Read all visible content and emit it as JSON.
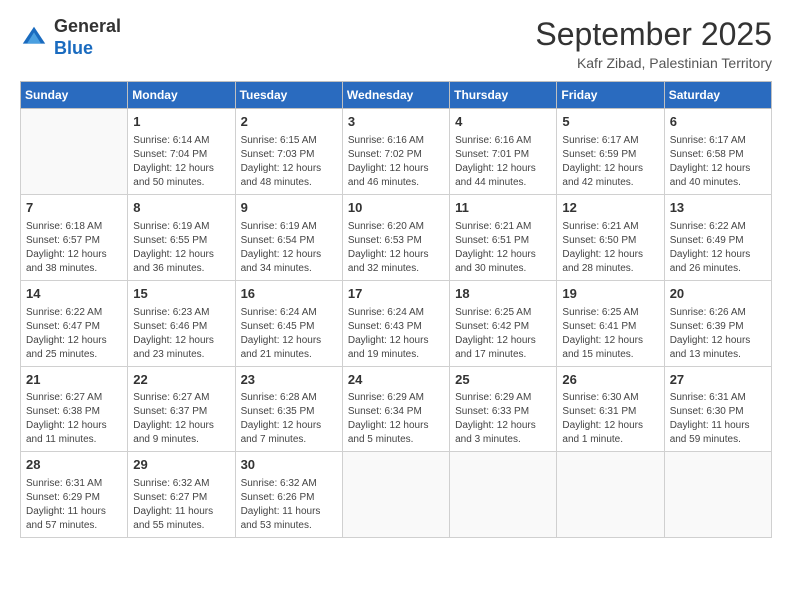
{
  "header": {
    "logo_line1": "General",
    "logo_line2": "Blue",
    "month": "September 2025",
    "location": "Kafr Zibad, Palestinian Territory"
  },
  "weekdays": [
    "Sunday",
    "Monday",
    "Tuesday",
    "Wednesday",
    "Thursday",
    "Friday",
    "Saturday"
  ],
  "weeks": [
    [
      {
        "day": "",
        "info": ""
      },
      {
        "day": "1",
        "info": "Sunrise: 6:14 AM\nSunset: 7:04 PM\nDaylight: 12 hours\nand 50 minutes."
      },
      {
        "day": "2",
        "info": "Sunrise: 6:15 AM\nSunset: 7:03 PM\nDaylight: 12 hours\nand 48 minutes."
      },
      {
        "day": "3",
        "info": "Sunrise: 6:16 AM\nSunset: 7:02 PM\nDaylight: 12 hours\nand 46 minutes."
      },
      {
        "day": "4",
        "info": "Sunrise: 6:16 AM\nSunset: 7:01 PM\nDaylight: 12 hours\nand 44 minutes."
      },
      {
        "day": "5",
        "info": "Sunrise: 6:17 AM\nSunset: 6:59 PM\nDaylight: 12 hours\nand 42 minutes."
      },
      {
        "day": "6",
        "info": "Sunrise: 6:17 AM\nSunset: 6:58 PM\nDaylight: 12 hours\nand 40 minutes."
      }
    ],
    [
      {
        "day": "7",
        "info": "Sunrise: 6:18 AM\nSunset: 6:57 PM\nDaylight: 12 hours\nand 38 minutes."
      },
      {
        "day": "8",
        "info": "Sunrise: 6:19 AM\nSunset: 6:55 PM\nDaylight: 12 hours\nand 36 minutes."
      },
      {
        "day": "9",
        "info": "Sunrise: 6:19 AM\nSunset: 6:54 PM\nDaylight: 12 hours\nand 34 minutes."
      },
      {
        "day": "10",
        "info": "Sunrise: 6:20 AM\nSunset: 6:53 PM\nDaylight: 12 hours\nand 32 minutes."
      },
      {
        "day": "11",
        "info": "Sunrise: 6:21 AM\nSunset: 6:51 PM\nDaylight: 12 hours\nand 30 minutes."
      },
      {
        "day": "12",
        "info": "Sunrise: 6:21 AM\nSunset: 6:50 PM\nDaylight: 12 hours\nand 28 minutes."
      },
      {
        "day": "13",
        "info": "Sunrise: 6:22 AM\nSunset: 6:49 PM\nDaylight: 12 hours\nand 26 minutes."
      }
    ],
    [
      {
        "day": "14",
        "info": "Sunrise: 6:22 AM\nSunset: 6:47 PM\nDaylight: 12 hours\nand 25 minutes."
      },
      {
        "day": "15",
        "info": "Sunrise: 6:23 AM\nSunset: 6:46 PM\nDaylight: 12 hours\nand 23 minutes."
      },
      {
        "day": "16",
        "info": "Sunrise: 6:24 AM\nSunset: 6:45 PM\nDaylight: 12 hours\nand 21 minutes."
      },
      {
        "day": "17",
        "info": "Sunrise: 6:24 AM\nSunset: 6:43 PM\nDaylight: 12 hours\nand 19 minutes."
      },
      {
        "day": "18",
        "info": "Sunrise: 6:25 AM\nSunset: 6:42 PM\nDaylight: 12 hours\nand 17 minutes."
      },
      {
        "day": "19",
        "info": "Sunrise: 6:25 AM\nSunset: 6:41 PM\nDaylight: 12 hours\nand 15 minutes."
      },
      {
        "day": "20",
        "info": "Sunrise: 6:26 AM\nSunset: 6:39 PM\nDaylight: 12 hours\nand 13 minutes."
      }
    ],
    [
      {
        "day": "21",
        "info": "Sunrise: 6:27 AM\nSunset: 6:38 PM\nDaylight: 12 hours\nand 11 minutes."
      },
      {
        "day": "22",
        "info": "Sunrise: 6:27 AM\nSunset: 6:37 PM\nDaylight: 12 hours\nand 9 minutes."
      },
      {
        "day": "23",
        "info": "Sunrise: 6:28 AM\nSunset: 6:35 PM\nDaylight: 12 hours\nand 7 minutes."
      },
      {
        "day": "24",
        "info": "Sunrise: 6:29 AM\nSunset: 6:34 PM\nDaylight: 12 hours\nand 5 minutes."
      },
      {
        "day": "25",
        "info": "Sunrise: 6:29 AM\nSunset: 6:33 PM\nDaylight: 12 hours\nand 3 minutes."
      },
      {
        "day": "26",
        "info": "Sunrise: 6:30 AM\nSunset: 6:31 PM\nDaylight: 12 hours\nand 1 minute."
      },
      {
        "day": "27",
        "info": "Sunrise: 6:31 AM\nSunset: 6:30 PM\nDaylight: 11 hours\nand 59 minutes."
      }
    ],
    [
      {
        "day": "28",
        "info": "Sunrise: 6:31 AM\nSunset: 6:29 PM\nDaylight: 11 hours\nand 57 minutes."
      },
      {
        "day": "29",
        "info": "Sunrise: 6:32 AM\nSunset: 6:27 PM\nDaylight: 11 hours\nand 55 minutes."
      },
      {
        "day": "30",
        "info": "Sunrise: 6:32 AM\nSunset: 6:26 PM\nDaylight: 11 hours\nand 53 minutes."
      },
      {
        "day": "",
        "info": ""
      },
      {
        "day": "",
        "info": ""
      },
      {
        "day": "",
        "info": ""
      },
      {
        "day": "",
        "info": ""
      }
    ]
  ]
}
